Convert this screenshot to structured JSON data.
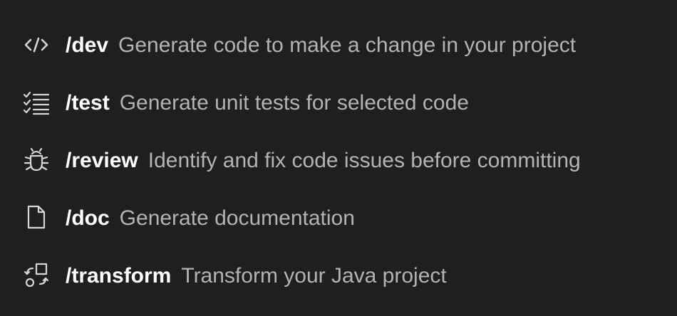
{
  "commands": [
    {
      "name": "/dev",
      "description": "Generate code to make a change in your project",
      "icon": "code-icon"
    },
    {
      "name": "/test",
      "description": "Generate unit tests for selected code",
      "icon": "checklist-icon"
    },
    {
      "name": "/review",
      "description": "Identify and fix code issues before committing",
      "icon": "bug-icon"
    },
    {
      "name": "/doc",
      "description": "Generate documentation",
      "icon": "file-icon"
    },
    {
      "name": "/transform",
      "description": "Transform your Java project",
      "icon": "transform-icon"
    }
  ]
}
